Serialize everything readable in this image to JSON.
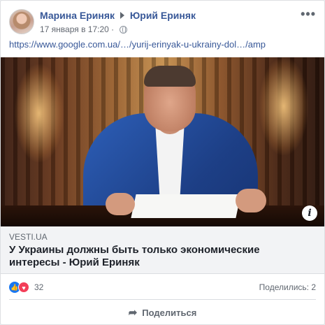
{
  "post": {
    "author": "Марина Ериняк",
    "target": "Юрий Ериняк",
    "timestamp": "17 января в 17:20 ·",
    "url_text": "https://www.google.com.ua/…/yurij-erinyak-u-ukrainy-dol…/amp",
    "more_icon": "•••"
  },
  "link_preview": {
    "domain": "VESTI.UA",
    "headline": "У Украины должны быть только экономические интересы - Юрий Ериняк",
    "info_icon": "i"
  },
  "stats": {
    "reaction_count": "32",
    "shares": "Поделились: 2",
    "reactions": [
      "like",
      "love"
    ]
  },
  "actions": {
    "share_label": "Поделиться"
  },
  "colors": {
    "link_blue": "#385898",
    "like_blue": "#1877f2",
    "love_red": "#f33e58"
  }
}
